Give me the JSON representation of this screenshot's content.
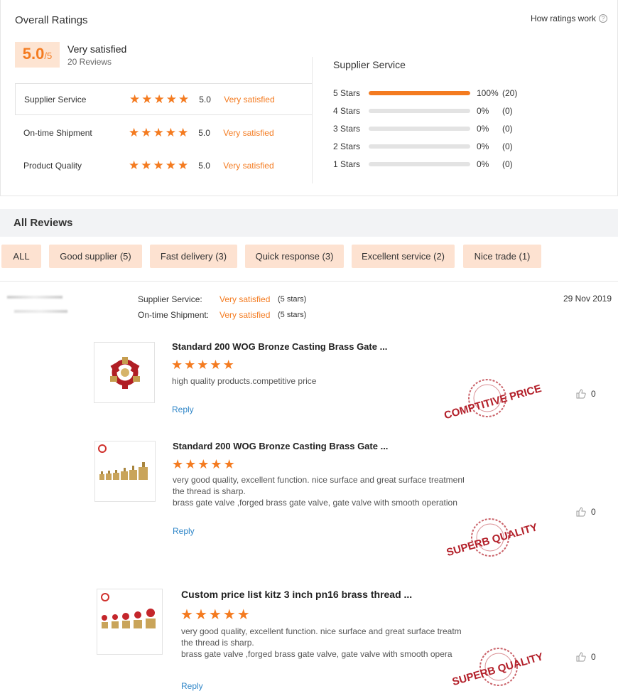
{
  "overall": {
    "title": "Overall Ratings",
    "how_link": "How ratings work",
    "help_icon": "?",
    "score": "5.0",
    "score_max": "/5",
    "label": "Very satisfied",
    "review_count": "20 Reviews"
  },
  "star_glyph": "★",
  "categories": [
    {
      "label": "Supplier Service",
      "score": "5.0",
      "satisfaction": "Very satisfied"
    },
    {
      "label": "On-time Shipment",
      "score": "5.0",
      "satisfaction": "Very satisfied"
    },
    {
      "label": "Product Quality",
      "score": "5.0",
      "satisfaction": "Very satisfied"
    }
  ],
  "distribution": {
    "title": "Supplier Service",
    "rows": [
      {
        "label": "5 Stars",
        "fraction": 1.0,
        "pct": "100%",
        "count": "(20)"
      },
      {
        "label": "4 Stars",
        "fraction": 0,
        "pct": "0%",
        "count": "(0)"
      },
      {
        "label": "3 Stars",
        "fraction": 0,
        "pct": "0%",
        "count": "(0)"
      },
      {
        "label": "2 Stars",
        "fraction": 0,
        "pct": "0%",
        "count": "(0)"
      },
      {
        "label": "1 Stars",
        "fraction": 0,
        "pct": "0%",
        "count": "(0)"
      }
    ]
  },
  "all_reviews": {
    "title": "All Reviews",
    "filters": [
      "ALL",
      "Good supplier (5)",
      "Fast delivery (3)",
      "Quick response (3)",
      "Excellent service (2)",
      "Nice trade (1)"
    ]
  },
  "review": {
    "date": "29 Nov 2019",
    "meta": [
      {
        "key": "Supplier Service:",
        "value": "Very satisfied",
        "stars": "(5 stars)"
      },
      {
        "key": "On-time Shipment:",
        "value": "Very satisfied",
        "stars": "(5 stars)"
      }
    ],
    "items": [
      {
        "title": "Standard 200 WOG Bronze Casting Brass Gate ...",
        "rating": 5,
        "lines": [
          "high quality products.competitive price"
        ],
        "reply": "Reply",
        "likes": "0",
        "stamp": "COMPTITIVE PRICE"
      },
      {
        "title": "Standard 200 WOG Bronze Casting Brass Gate ...",
        "rating": 5,
        "lines": [
          "very good quality, excellent function. nice surface and great surface treatment.",
          "the thread is sharp.",
          "brass gate valve ,forged brass gate valve, gate valve with smooth operation"
        ],
        "reply": "Reply",
        "likes": "0",
        "stamp": "SUPERB QUALITY"
      },
      {
        "title": "Custom price list kitz 3 inch pn16 brass thread ...",
        "rating": 5,
        "lines": [
          "very good quality, excellent function. nice surface and great surface treatmer",
          "the thread is sharp.",
          "brass gate valve ,forged brass gate valve, gate valve with smooth opera"
        ],
        "reply": "Reply",
        "likes": "0",
        "stamp": "SUPERB QUALITY"
      }
    ]
  },
  "colors": {
    "accent": "#f47b20",
    "chip_bg": "#fde2d1",
    "stamp": "#b3202a",
    "link": "#2f86c8"
  }
}
